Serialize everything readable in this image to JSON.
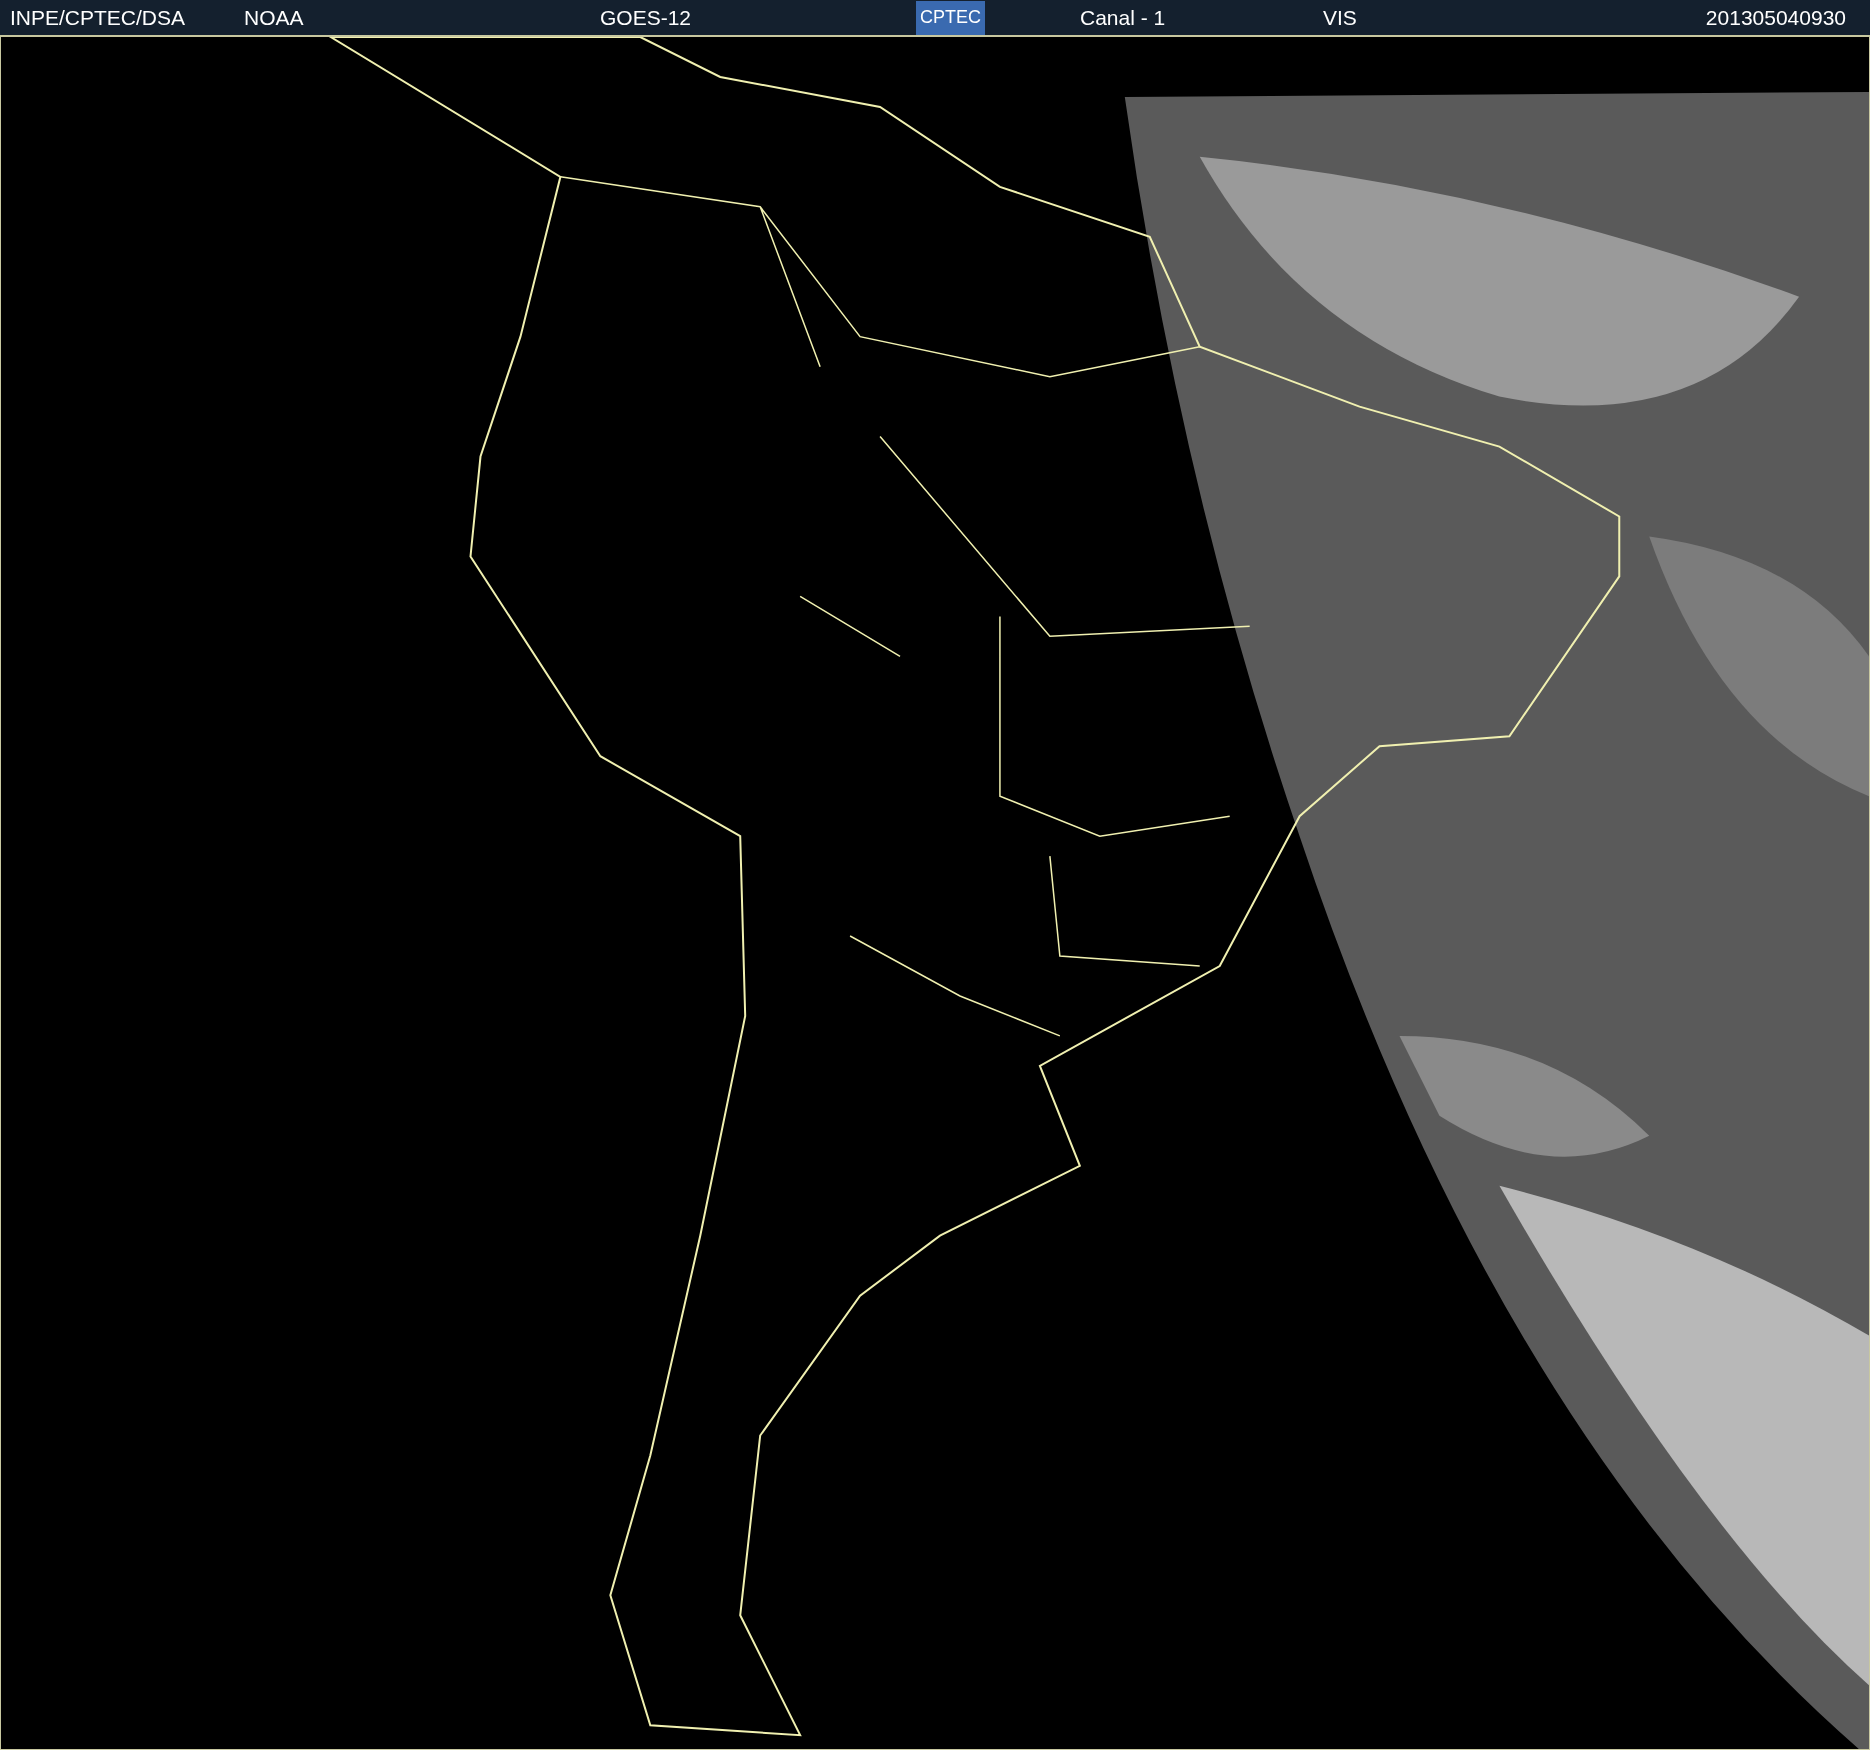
{
  "header": {
    "source": "INPE/CPTEC/DSA",
    "agency": "NOAA",
    "satellite": "GOES-12",
    "logo": "CPTEC",
    "channel": "Canal - 1",
    "band": "VIS",
    "timestamp": "201305040930"
  }
}
